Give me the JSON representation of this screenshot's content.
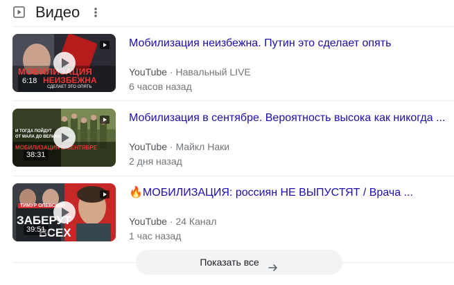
{
  "section": {
    "title": "Видео",
    "play_icon": "play-square-icon",
    "more_icon": "more-vert-icon"
  },
  "videos": [
    {
      "title": "Мобилизация неизбежна. Путин это сделает опять",
      "source": "YouTube",
      "channel": "Навальный LIVE",
      "time": "6 часов назад",
      "duration": "6:18",
      "thumb_text_1": "МОБИЛИЗАЦИЯ",
      "thumb_text_2": "НЕИЗБЕЖНА",
      "thumb_text_3": "СДЕЛАЕТ ЭТО ОПЯТЬ"
    },
    {
      "title": "Мобилизация в сентябре. Вероятность высока как никогда ...",
      "source": "YouTube",
      "channel": "Майкл Наки",
      "time": "2 дня назад",
      "duration": "38:31",
      "thumb_text_1": "МОБИЛИЗАЦИЯ В СЕНТЯБРЕ",
      "thumb_text_2": "И ТОГДА ПОЙДУТ",
      "thumb_text_3": "ОТ МАЛА ДО ВЕЛИКА"
    },
    {
      "title": "🔥МОБИЛИЗАЦИЯ: россиян НЕ ВЫПУСТЯТ / Врача ...",
      "source": "YouTube",
      "channel": "24 Канал",
      "time": "1 час назад",
      "duration": "39:51",
      "thumb_text_1": "ТИМУР ОЛЕВСКИЙ",
      "thumb_text_2": "ЗАБЕРУТ",
      "thumb_text_3": "ВСЕХ"
    }
  ],
  "footer": {
    "show_all_label": "Показать все",
    "arrow_icon": "arrow-right-icon"
  },
  "colors": {
    "link": "#1a0dab",
    "meta": "#70757a",
    "button_bg": "#f1f3f4",
    "thumb_red": "#d32f2f"
  }
}
